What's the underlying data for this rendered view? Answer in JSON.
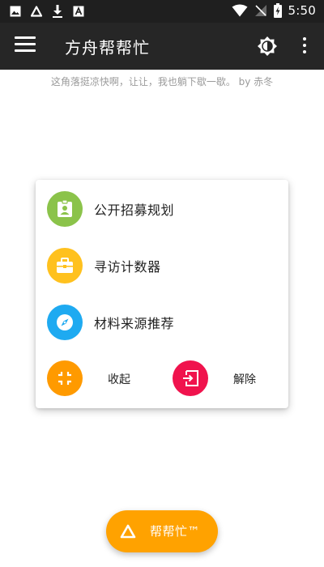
{
  "status_bar": {
    "time": "5:50",
    "icons": [
      "image-icon",
      "delta-icon",
      "download-icon",
      "a-badge-icon",
      "wifi-icon",
      "no-sim-icon",
      "battery-charging-icon"
    ]
  },
  "app_bar": {
    "title": "方舟帮帮忙",
    "icons": [
      "menu-icon",
      "brightness-icon",
      "more-vert-icon"
    ]
  },
  "notice": "这角落挺凉快啊，让让，我也躺下歇一歇。 by 赤冬",
  "menu": {
    "items": [
      {
        "label": "公开招募规划",
        "icon": "id-badge-icon",
        "color": "#8bc34a"
      },
      {
        "label": "寻访计数器",
        "icon": "briefcase-icon",
        "color": "#ffc11e"
      },
      {
        "label": "材料来源推荐",
        "icon": "compass-icon",
        "color": "#1eaaf1"
      }
    ],
    "collapse_label": "收起",
    "collapse_color": "#ff9a00",
    "dismiss_label": "解除",
    "dismiss_color": "#f0134d"
  },
  "fab": {
    "label": "帮帮忙™",
    "color": "#ffa200",
    "icon": "delta-icon"
  }
}
